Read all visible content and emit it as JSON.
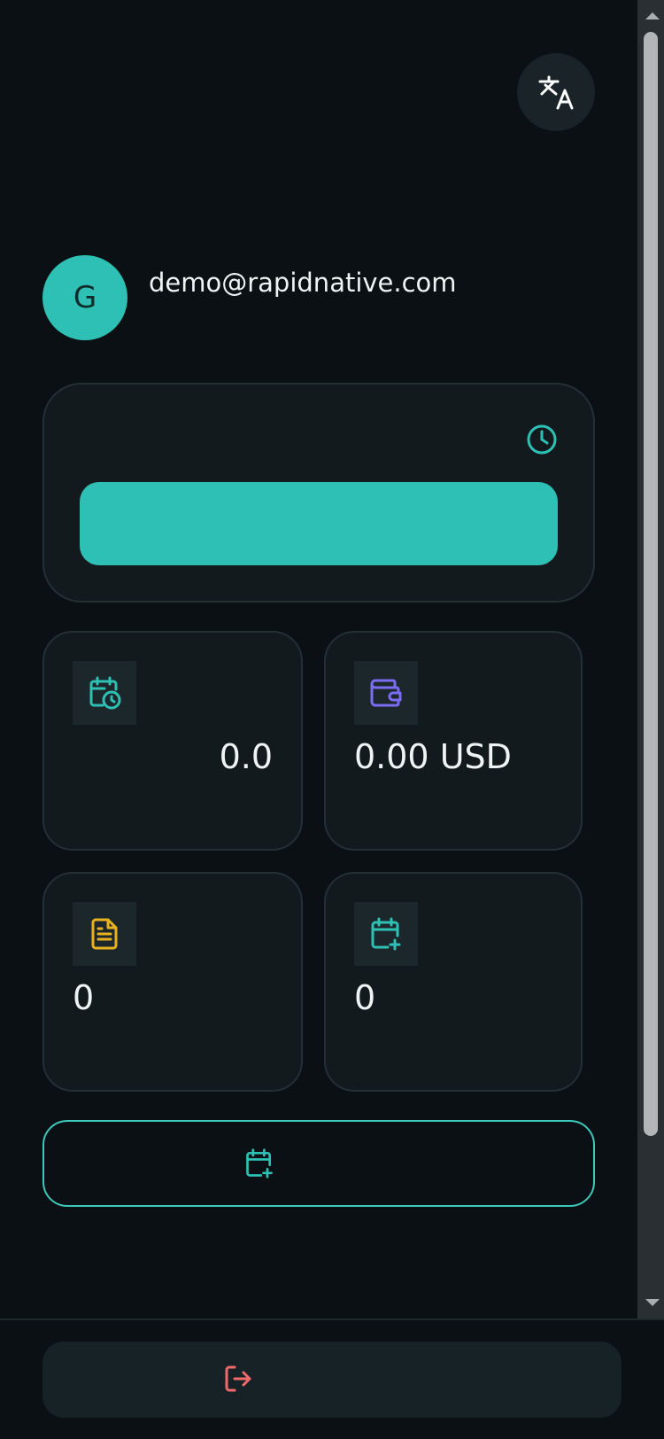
{
  "header": {
    "translate_icon": "translate-icon"
  },
  "profile": {
    "avatar_initial": "G",
    "email": "demo@rapidnative.com"
  },
  "hero": {
    "icon": "clock-icon",
    "button_color": "#2ec0b4"
  },
  "stats": [
    {
      "icon": "calendar-clock-icon",
      "value": "0.0",
      "color": "#2ec0b4"
    },
    {
      "icon": "wallet-icon",
      "value": "0.00 USD",
      "color": "#7c6cf0"
    },
    {
      "icon": "document-icon",
      "value": "0",
      "color": "#e8b21f"
    },
    {
      "icon": "calendar-plus-icon",
      "value": "0",
      "color": "#2ec0b4"
    }
  ],
  "actions": {
    "add_icon": "calendar-plus-icon",
    "logout_icon": "logout-icon",
    "logout_color": "#f06a6a"
  },
  "theme": {
    "accent": "#2ec0b4",
    "background": "#0a1013",
    "card": "#121a1e"
  }
}
